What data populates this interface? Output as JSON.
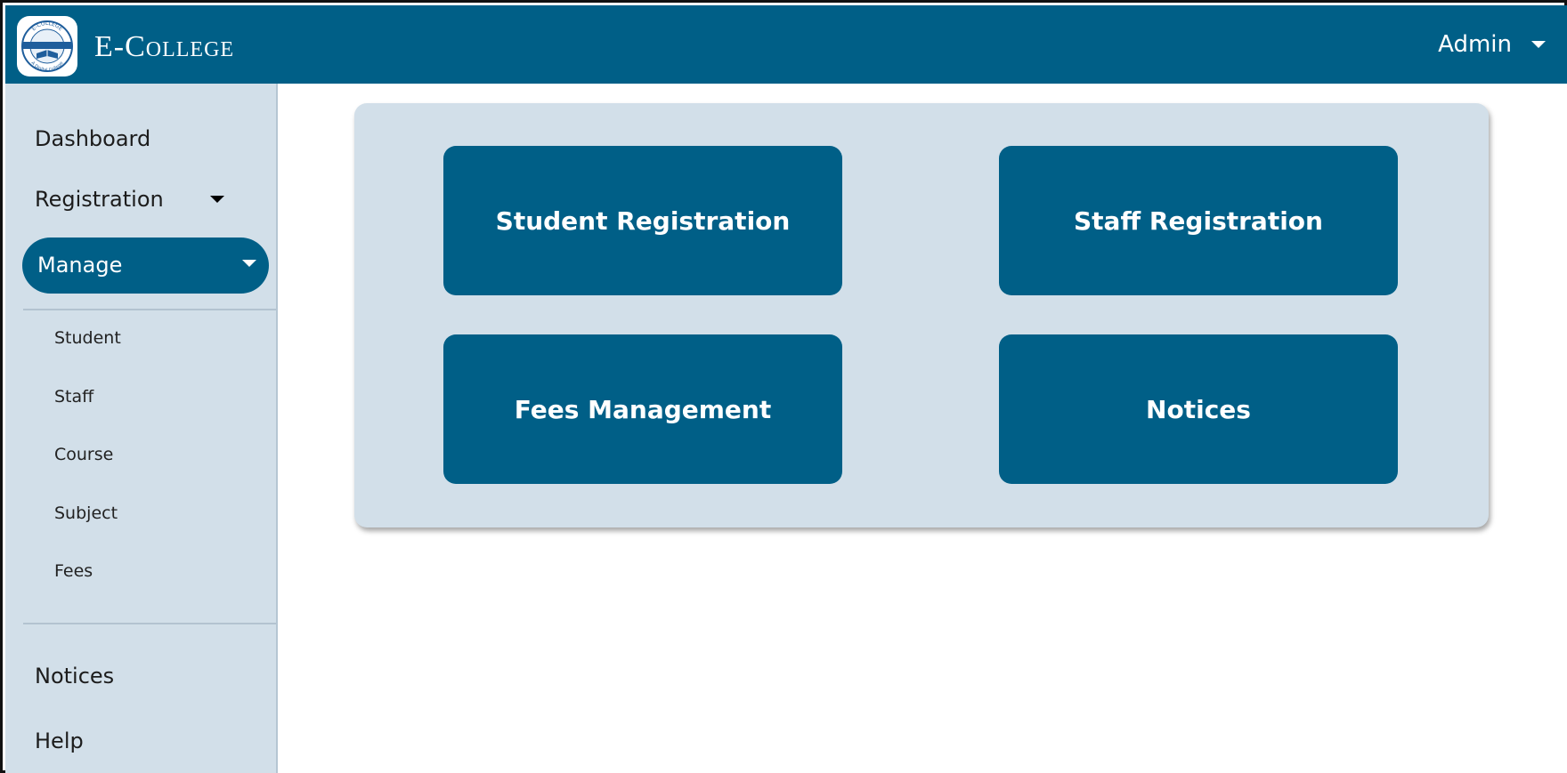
{
  "header": {
    "app_title": "E-College",
    "user_label": "Admin",
    "logo": {
      "text_top": "E-COLLEGE",
      "text_bottom": "A Digital College"
    }
  },
  "sidebar": {
    "items": [
      {
        "label": "Dashboard"
      },
      {
        "label": "Registration",
        "has_caret": true
      },
      {
        "label": "Manage",
        "has_caret": true,
        "active": true
      }
    ],
    "sub_items": [
      {
        "label": "Student"
      },
      {
        "label": "Staff"
      },
      {
        "label": "Course"
      },
      {
        "label": "Subject"
      },
      {
        "label": "Fees"
      }
    ],
    "bottom_items": [
      {
        "label": "Notices"
      },
      {
        "label": "Help"
      }
    ]
  },
  "main": {
    "tiles": [
      {
        "label": "Student Registration"
      },
      {
        "label": "Staff Registration"
      },
      {
        "label": "Fees Management"
      },
      {
        "label": "Notices"
      }
    ]
  },
  "colors": {
    "primary": "#005f87",
    "sidebar_bg": "#d2dfe9",
    "panel_bg": "#d2dfe9",
    "text_dark": "#1c1c1c",
    "white": "#ffffff"
  },
  "icons": [
    "logo-icon",
    "chevron-down-icon"
  ]
}
